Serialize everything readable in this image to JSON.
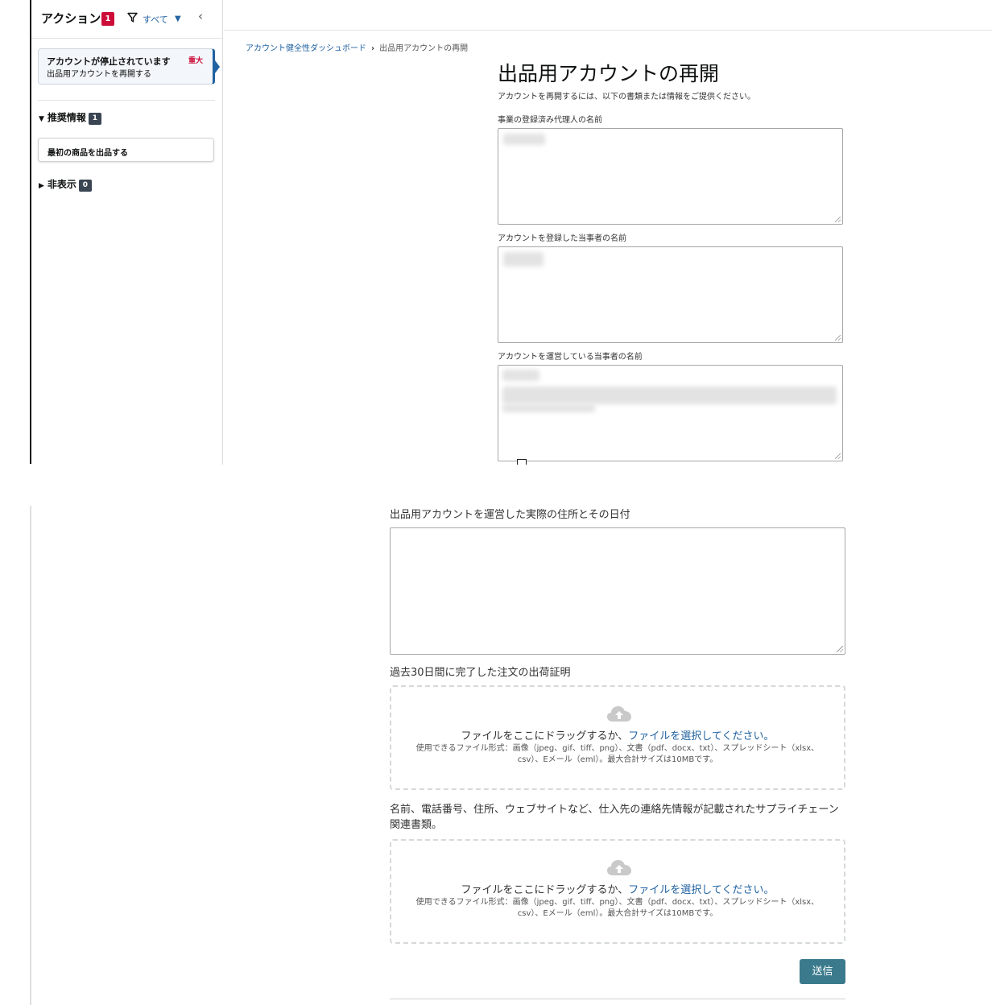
{
  "sidebar": {
    "title": "アクション",
    "count": "1",
    "filter_label": "すべて",
    "collapse_icon": "chevron-left-icon",
    "action_card": {
      "title": "アカウントが停止されています",
      "subtitle": "出品用アカウントを再開する",
      "severity": "重大"
    },
    "recommended": {
      "label": "推奨情報",
      "count": "1",
      "items": [
        "最初の商品を出品する"
      ]
    },
    "hidden": {
      "label": "非表示",
      "count": "0"
    }
  },
  "breadcrumb": {
    "parent": "アカウント健全性ダッシュボード",
    "current": "出品用アカウントの再開"
  },
  "form": {
    "title": "出品用アカウントの再開",
    "description": "アカウントを再開するには、以下の書類または情報をご提供ください。",
    "fields": [
      {
        "label": "事業の登録済み代理人の名前"
      },
      {
        "label": "アカウントを登録した当事者の名前"
      },
      {
        "label": "アカウントを運営している当事者の名前"
      }
    ],
    "address_label": "出品用アカウントを運営した実際の住所とその日付",
    "uploads": [
      {
        "label": "過去30日間に完了した注文の出荷証明",
        "drag_text": "ファイルをここにドラッグするか、",
        "select_link": "ファイルを選択してください。",
        "formats": "使用できるファイル形式：画像（jpeg、gif、tiff、png）、文書（pdf、docx、txt）、スプレッドシート（xlsx、csv）、Eメール（eml）。最大合計サイズは10MBです。"
      },
      {
        "label": "名前、電話番号、住所、ウェブサイトなど、仕入先の連絡先情報が記載されたサプライチェーン関連書類。",
        "drag_text": "ファイルをここにドラッグするか、",
        "select_link": "ファイルを選択してください。",
        "formats": "使用できるファイル形式：画像（jpeg、gif、tiff、png）、文書（pdf、docx、txt）、スプレッドシート（xlsx、csv）、Eメール（eml）。最大合計サイズは10MBです。"
      }
    ],
    "submit": "送信"
  },
  "colors": {
    "link": "#2162a1",
    "critical": "#cc0c39",
    "submit": "#3a7a8c"
  }
}
